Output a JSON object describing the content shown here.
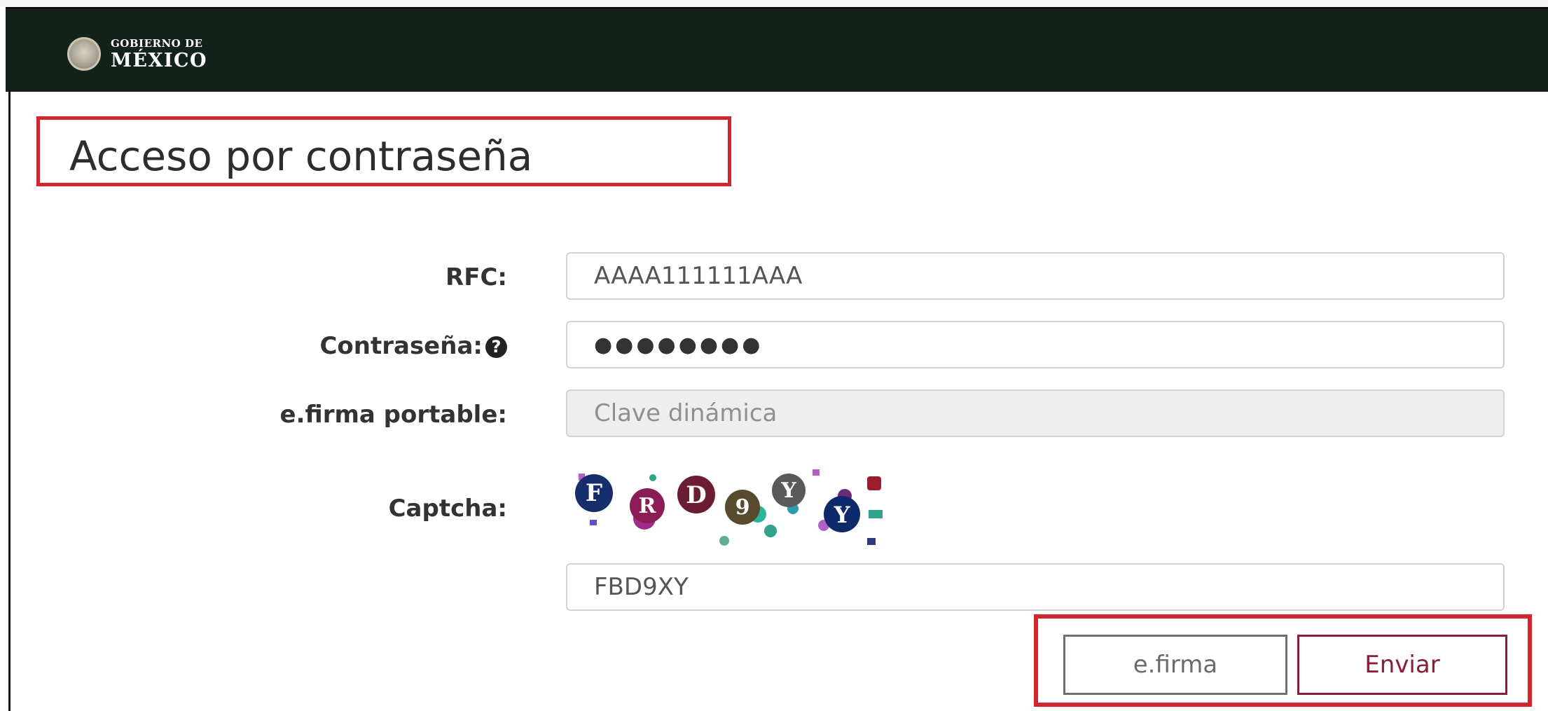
{
  "header": {
    "logo_line1": "GOBIERNO DE",
    "logo_line2": "MÉXICO",
    "background_color": "#13231c"
  },
  "page": {
    "title": "Acceso por contraseña"
  },
  "form": {
    "rfc": {
      "label": "RFC:",
      "value": "AAAA111111AAA"
    },
    "password": {
      "label": "Contraseña:",
      "help_icon": "question-circle-icon",
      "masked_value": "●●●●●●●●"
    },
    "efirma_portable": {
      "label": "e.firma portable:",
      "placeholder": "Clave dinámica",
      "disabled": true
    },
    "captcha": {
      "label": "Captcha:",
      "image_characters": [
        "F",
        "R",
        "D",
        "9",
        "Y",
        "Y"
      ],
      "value": "FBD9XY"
    }
  },
  "buttons": {
    "efirma_label": "e.firma",
    "enviar_label": "Enviar",
    "enviar_color": "#8a1c3c"
  },
  "annotation_color": "#d4252f"
}
